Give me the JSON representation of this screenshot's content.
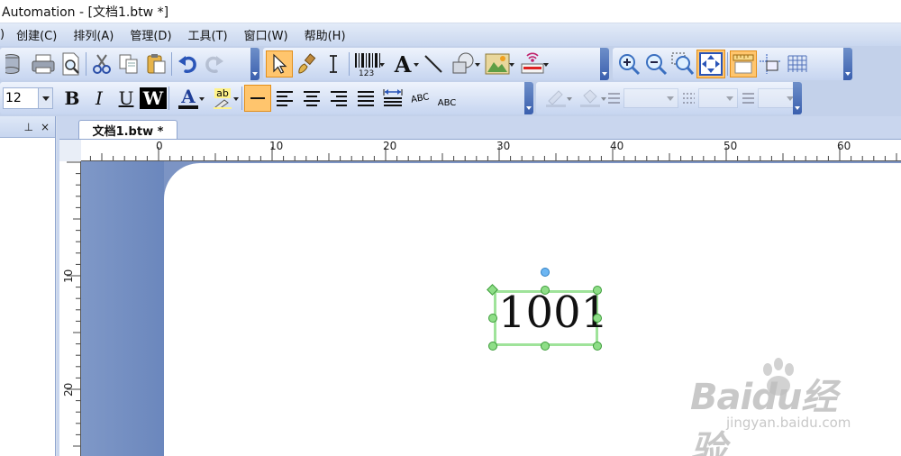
{
  "window": {
    "title": "Automation - [文档1.btw *]"
  },
  "menu": {
    "items": [
      ")",
      "创建(C)",
      "排列(A)",
      "管理(D)",
      "工具(T)",
      "窗口(W)",
      "帮助(H)"
    ]
  },
  "format_toolbar": {
    "font_size": "12",
    "bold_label": "B",
    "italic_label": "I",
    "underline_label": "U",
    "white_text_label": "W",
    "font_color_label": "A",
    "highlight_label": "ab",
    "abc_label": "ABC"
  },
  "main_toolbar": {
    "barcode_label": "123"
  },
  "document": {
    "tab_label": "文档1.btw *"
  },
  "panel": {
    "pin_label": "⊥",
    "close_label": "×"
  },
  "rulers": {
    "horizontal_labels": [
      "0",
      "10",
      "20",
      "30",
      "40",
      "50",
      "60"
    ],
    "vertical_labels": [
      "10",
      "20"
    ]
  },
  "label_object": {
    "text": "1001",
    "selection_color": "#9fe39a"
  },
  "watermark": {
    "brand": "Baidu经验",
    "url": "jingyan.baidu.com"
  }
}
